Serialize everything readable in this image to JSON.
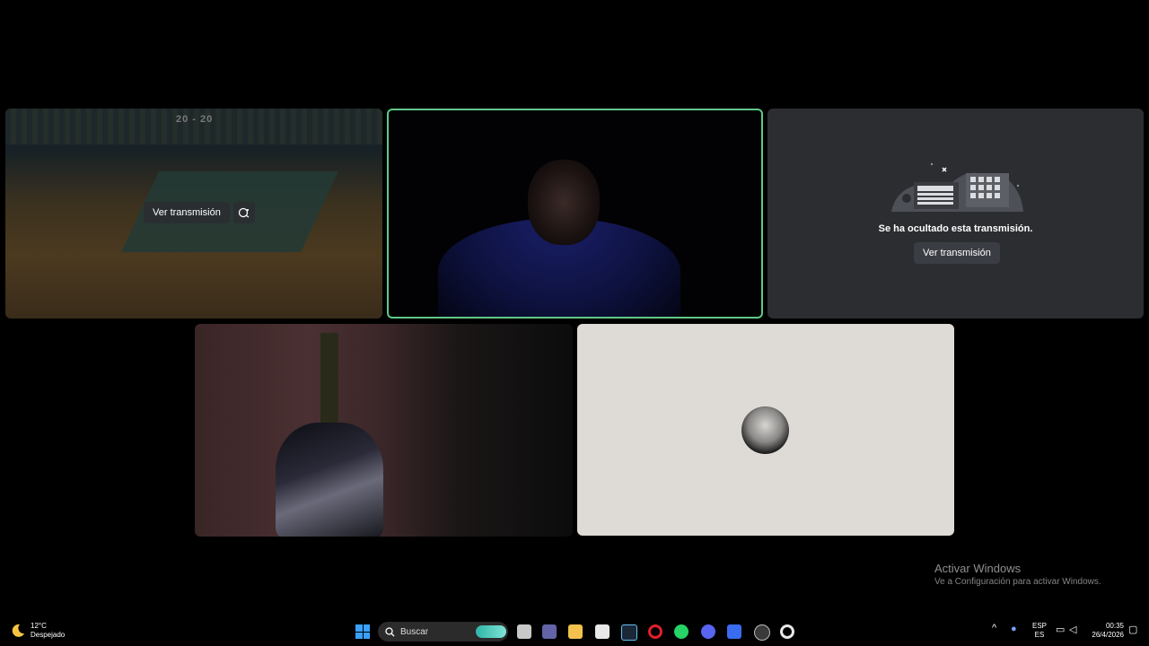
{
  "tiles": {
    "game": {
      "watch_label": "Ver transmisión",
      "score": "20 - 20"
    },
    "hidden": {
      "message": "Se ha ocultado esta transmisión.",
      "watch_label": "Ver transmisión"
    }
  },
  "watermark": {
    "title": "Activar Windows",
    "subtitle": "Ve a Configuración para activar Windows."
  },
  "taskbar": {
    "weather": {
      "temp": "12°C",
      "condition": "Despejado"
    },
    "search_label": "Buscar",
    "apps": [
      "task-view-icon",
      "teams-icon",
      "file-explorer-icon",
      "store-icon",
      "steam-icon",
      "opera-icon",
      "whatsapp-icon",
      "discord-icon",
      "roblox-icon",
      "obs-icon",
      "settings-icon"
    ],
    "language": {
      "line1": "ESP",
      "line2": "ES"
    },
    "clock": {
      "time": "00:35",
      "date": "26/4/2026"
    }
  },
  "colors": {
    "active_speaker": "#5fc987",
    "tile_dark": "#2b2d31",
    "avatar_tile": "#dedbd6"
  }
}
